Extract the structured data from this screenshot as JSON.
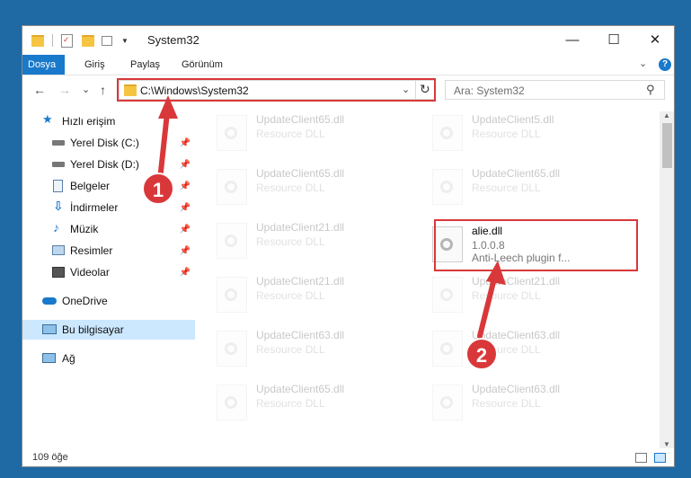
{
  "window": {
    "title": "System32",
    "controls": {
      "minimize": "—",
      "maximize": "☐",
      "close": "✕"
    }
  },
  "ribbon": {
    "tabs": [
      {
        "label": "Dosya"
      },
      {
        "label": "Giriş"
      },
      {
        "label": "Paylaş"
      },
      {
        "label": "Görünüm"
      }
    ],
    "expand": "⌄",
    "help": "?"
  },
  "navigation": {
    "back": "←",
    "forward": "→",
    "recent": "⌄",
    "up": "↑",
    "address": "C:\\Windows\\System32",
    "address_dropdown": "⌄",
    "refresh": "↻",
    "search_placeholder": "Ara: System32",
    "search_icon": "⚲"
  },
  "sidebar": {
    "items": [
      {
        "label": "Hızlı erişim",
        "icon": "star-icon"
      },
      {
        "label": "Yerel Disk (C:)",
        "icon": "drive-icon"
      },
      {
        "label": "Yerel Disk (D:)",
        "icon": "drive-icon"
      },
      {
        "label": "Belgeler",
        "icon": "documents-icon"
      },
      {
        "label": "İndirmeler",
        "icon": "download-icon"
      },
      {
        "label": "Müzik",
        "icon": "music-icon"
      },
      {
        "label": "Resimler",
        "icon": "pictures-icon"
      },
      {
        "label": "Videolar",
        "icon": "videos-icon"
      },
      {
        "label": "OneDrive",
        "icon": "cloud-icon"
      },
      {
        "label": "Bu bilgisayar",
        "icon": "computer-icon"
      },
      {
        "label": "Ağ",
        "icon": "network-icon"
      }
    ],
    "pin": "📌"
  },
  "files": [
    {
      "name": "UpdateClient65.dll",
      "desc": "Resource DLL"
    },
    {
      "name": "UpdateClient5.dll",
      "desc": "Resource DLL"
    },
    {
      "name": "UpdateClient65.dll",
      "desc": "Resource DLL"
    },
    {
      "name": "UpdateClient65.dll",
      "desc": "Resource DLL"
    },
    {
      "name": "UpdateClient21.dll",
      "desc": "Resource DLL"
    },
    {
      "name": "alie.dll",
      "version": "1.0.0.8",
      "desc": "Anti-Leech plugin f..."
    },
    {
      "name": "UpdateClient21.dll",
      "desc": "Resource DLL"
    },
    {
      "name": "UpdateClient21.dll",
      "desc": "Resource DLL"
    },
    {
      "name": "UpdateClient63.dll",
      "desc": "Resource DLL"
    },
    {
      "name": "UpdateClient63.dll",
      "desc": "Resource DLL"
    },
    {
      "name": "UpdateClient65.dll",
      "desc": "Resource DLL"
    },
    {
      "name": "UpdateClient63.dll",
      "desc": "Resource DLL"
    }
  ],
  "status": {
    "count": "109 öğe"
  },
  "annotations": {
    "step1": "1",
    "step2": "2",
    "color": "#d9383a"
  },
  "colors": {
    "accent": "#1979ca",
    "selection": "#cce8ff",
    "desktop": "#1f6aa5"
  }
}
